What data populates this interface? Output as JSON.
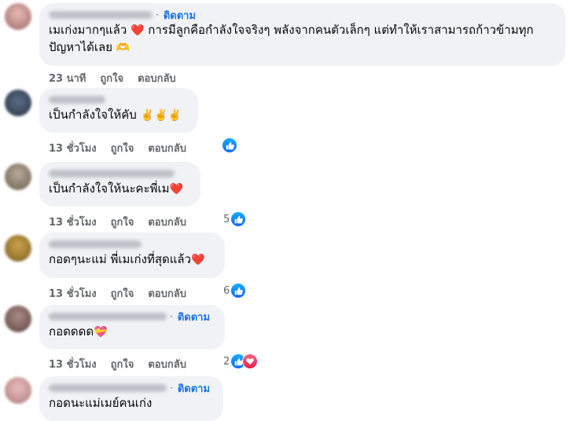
{
  "comments": [
    {
      "follow": "ติดตาม",
      "text": "เมเก่งมากๆแล้ว",
      "emoji1": "❤️",
      "text2": " การมีลูกคือกำลังใจจริงๆ พลังจากคนตัวเล็กๆ แต่ทำให้เราสามารถก้าวข้ามทุก",
      "text3": "ปัญหาได้เลย",
      "emoji2": "🫶",
      "time": "23 นาที",
      "like_label": "ถูกใจ",
      "reply_label": "ตอบกลับ"
    },
    {
      "text": "เป็นกำลังใจให้คับ",
      "emoji1": "✌️✌️✌️",
      "time": "13 ชั่วโมง",
      "like_label": "ถูกใจ",
      "reply_label": "ตอบกลับ",
      "reactions": [
        "like-icon"
      ]
    },
    {
      "text": "เป็นกำลังใจให้นะคะพี่เม",
      "emoji1": "❤️",
      "time": "13 ชั่วโมง",
      "like_label": "ถูกใจ",
      "reply_label": "ตอบกลับ",
      "reaction_count": "5",
      "reactions": [
        "like-icon"
      ]
    },
    {
      "text": "กอดๆนะแม่ พี่เมเก่งที่สุดแล้ว",
      "emoji1": "❤️",
      "time": "13 ชั่วโมง",
      "like_label": "ถูกใจ",
      "reply_label": "ตอบกลับ",
      "reaction_count": "6",
      "reactions": [
        "like-icon"
      ]
    },
    {
      "follow": "ติดตาม",
      "text": "กอดดดด",
      "emoji1": "💝",
      "time": "13 ชั่วโมง",
      "like_label": "ถูกใจ",
      "reply_label": "ตอบกลับ",
      "reaction_count": "2",
      "reactions": [
        "like-icon",
        "love-icon"
      ]
    },
    {
      "follow": "ติดตาม",
      "text": "กอดนะแม่เมย์คนเก่ง"
    }
  ],
  "colors": {
    "bubble": "#f0f2f5",
    "follow": "#1b74e4",
    "meta": "#65676b",
    "like": "#0866ff",
    "love": "#e61e4d"
  }
}
